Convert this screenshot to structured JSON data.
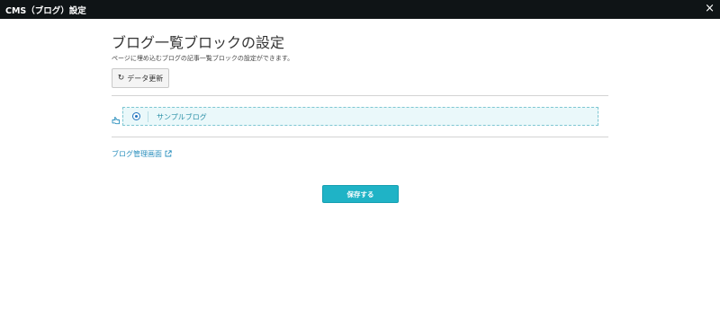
{
  "window": {
    "title": "CMS（ブログ）設定",
    "close_label": "×"
  },
  "main": {
    "page_title": "ブログ一覧ブロックの設定",
    "description": "ページに埋め込むブログの記事一覧ブロックの設定ができます。",
    "refresh_button": {
      "icon": "refresh-icon",
      "label": "データ更新"
    },
    "blogs": [
      {
        "name": "サンプルブログ",
        "selected": true,
        "drag_icon": "pointing-hand-icon"
      }
    ],
    "manage_link": {
      "label": "ブログ管理画面",
      "icon": "external-link-icon"
    },
    "save_button": {
      "label": "保存する"
    }
  },
  "colors": {
    "titlebar": "#0f1416",
    "accent": "#1fb3c6",
    "link": "#2a8fbd",
    "row_background": "#eaf8fa",
    "row_border": "#7ec6d2"
  }
}
